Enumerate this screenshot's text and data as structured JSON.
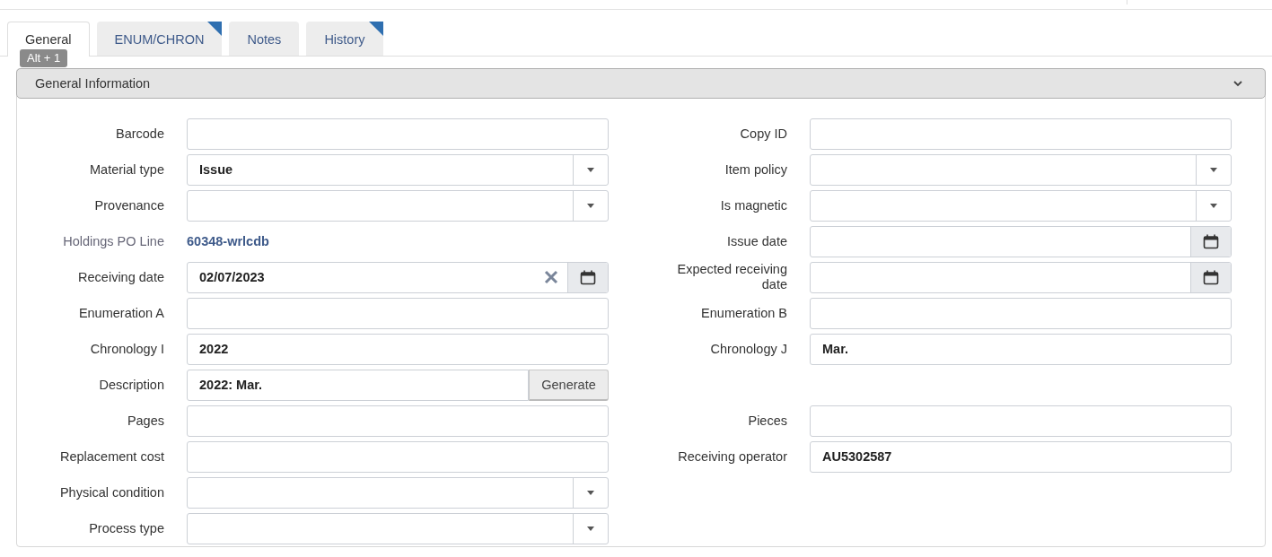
{
  "tabs": [
    {
      "label": "General",
      "selected": true,
      "flagged": false
    },
    {
      "label": "ENUM/CHRON",
      "selected": false,
      "flagged": true
    },
    {
      "label": "Notes",
      "selected": false,
      "flagged": false
    },
    {
      "label": "History",
      "selected": false,
      "flagged": true
    }
  ],
  "tooltip": "Alt + 1",
  "section": {
    "title": "General Information",
    "expanded": true
  },
  "rows": [
    {
      "left": {
        "kind": "text",
        "label": "Barcode"
      },
      "right": {
        "kind": "text",
        "label": "Copy ID"
      }
    },
    {
      "left": {
        "kind": "select",
        "label": "Material type",
        "value": "Issue"
      },
      "right": {
        "kind": "select",
        "label": "Item policy"
      }
    },
    {
      "left": {
        "kind": "select",
        "label": "Provenance"
      },
      "right": {
        "kind": "select",
        "label": "Is magnetic"
      }
    },
    {
      "left": {
        "kind": "link",
        "label": "Holdings PO Line",
        "value": "60348-wrlcdb"
      },
      "right": {
        "kind": "date",
        "label": "Issue date"
      }
    },
    {
      "left": {
        "kind": "date",
        "label": "Receiving date",
        "value": "02/07/2023"
      },
      "right": {
        "kind": "date",
        "label": "Expected receiving date"
      }
    },
    {
      "left": {
        "kind": "text",
        "label": "Enumeration A"
      },
      "right": {
        "kind": "text",
        "label": "Enumeration B"
      }
    },
    {
      "left": {
        "kind": "text",
        "label": "Chronology I",
        "value": "2022"
      },
      "right": {
        "kind": "text",
        "label": "Chronology J",
        "value": "Mar."
      }
    },
    {
      "left": {
        "kind": "generate",
        "label": "Description",
        "value": "2022: Mar.",
        "button": "Generate"
      },
      "right": null
    },
    {
      "left": {
        "kind": "text",
        "label": "Pages"
      },
      "right": {
        "kind": "text",
        "label": "Pieces"
      }
    },
    {
      "left": {
        "kind": "text",
        "label": "Replacement cost"
      },
      "right": {
        "kind": "text",
        "label": "Receiving operator",
        "value": "AU5302587"
      }
    },
    {
      "left": {
        "kind": "select",
        "label": "Physical condition"
      },
      "right": null
    },
    {
      "left": {
        "kind": "select",
        "label": "Process type"
      },
      "right": null
    }
  ]
}
